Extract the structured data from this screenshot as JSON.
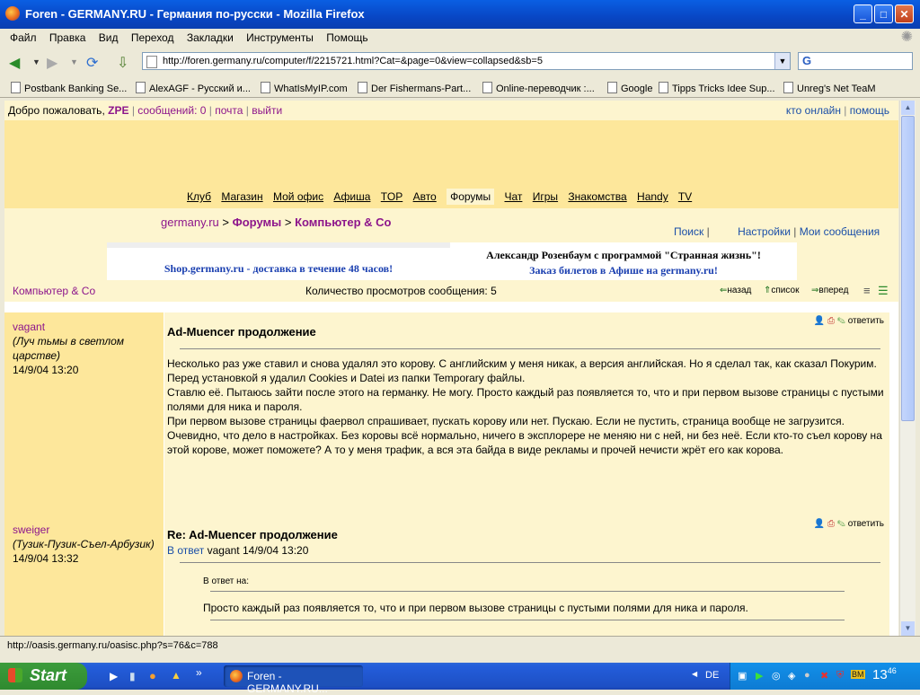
{
  "window": {
    "title": "Foren - GERMANY.RU - Германия по-русски - Mozilla Firefox",
    "buttons": {
      "minimize": "_",
      "maximize": "□",
      "close": "✕"
    }
  },
  "menu": [
    "Файл",
    "Правка",
    "Вид",
    "Переход",
    "Закладки",
    "Инструменты",
    "Помощь"
  ],
  "address": {
    "url": "http://foren.germany.ru/computer/f/2215721.html?Cat=&page=0&view=collapsed&sb=5"
  },
  "bookmarks": [
    {
      "label": "Postbank Banking Se..."
    },
    {
      "label": "AlexAGF - Русский и..."
    },
    {
      "label": "WhatIsMyIP.com"
    },
    {
      "label": "Der Fishermans-Part..."
    },
    {
      "label": "Online-переводчик :..."
    },
    {
      "label": "Google"
    },
    {
      "label": "Tipps Tricks Idee Sup..."
    },
    {
      "label": "Unreg's Net TeaM"
    }
  ],
  "page": {
    "welcome": "Добро пожаловать,",
    "user": "ZPE",
    "messages": "сообщений: 0",
    "mail": "почта",
    "logout": "выйти",
    "who_online": "кто онлайн",
    "help": "помощь",
    "nav": [
      "Клуб",
      "Магазин",
      "Мой офис",
      "Афиша",
      "TOP",
      "Авто",
      "Форумы",
      "Чат",
      "Игры",
      "Знакомства",
      "Handy",
      "TV"
    ],
    "nav_active": "Форумы",
    "breadcrumb": {
      "home": "germany.ru",
      "sep": ">",
      "forums": "Форумы",
      "section": "Компьютер & Co"
    },
    "search": "Поиск",
    "settings": "Настройки",
    "my_messages": "Мои сообщения",
    "ad_left": "Shop.germany.ru - доставка в течение 48 часов!",
    "ad_right_title": "Александр Розенбаум с программой \"Странная жизнь\"!",
    "ad_right_sub": "Заказ билетов в Афише на germany.ru!",
    "section_label": "Компьютер & Co",
    "views": "Количество просмотров сообщения: 5",
    "back": "назад",
    "list": "список",
    "forward": "вперед",
    "reply": "ответить",
    "posts": [
      {
        "author": "vagant",
        "status": "(Луч тьмы в светлом царстве)",
        "date": "14/9/04 13:20",
        "subject": "Ad-Muencer продолжение",
        "body": [
          "Несколько раз уже ставил и снова удалял это корову. С английским у меня никак, а версия английская. Но я сделал так, как сказал Покурим. Перед установкой я удалил Cookies и Datei из папки Temporary файлы.",
          "Ставлю её. Пытаюсь зайти после этого на германку. Не могу. Просто каждый раз появляется то, что и при первом вызове страницы с пустыми полями для ника и пароля.",
          "При первом вызове страницы фаервол спрашивает, пускать корову или нет. Пускаю. Если не пустить, страница вообще не загрузится. Очевидно, что дело в настройках. Без коровы всё нормально, ничего в эксплорере не меняю ни с ней, ни без неё. Если кто-то съел корову на этой корове, может поможете? А то у меня трафик, а вся эта байда в виде рекламы и прочей нечисти жрёт его как корова."
        ]
      },
      {
        "author": "sweiger",
        "status": "(Тузик-Пузик-Съел-Арбузик)",
        "date": "14/9/04 13:32",
        "subject": "Re: Ad-Muencer продолжение",
        "reply_to_label": "В ответ",
        "reply_to": "vagant 14/9/04 13:20",
        "quote_label": "В ответ на:",
        "quote": "Просто каждый раз появляется то, что и при первом вызове страницы с пустыми полями для ника и пароля."
      }
    ]
  },
  "status": "http://oasis.germany.ru/oasisc.php?s=76&c=788",
  "taskbar": {
    "start": "Start",
    "task": "Foren - GERMANY.RU...",
    "lang": "DE",
    "clock": "13",
    "clock_min": "46"
  }
}
